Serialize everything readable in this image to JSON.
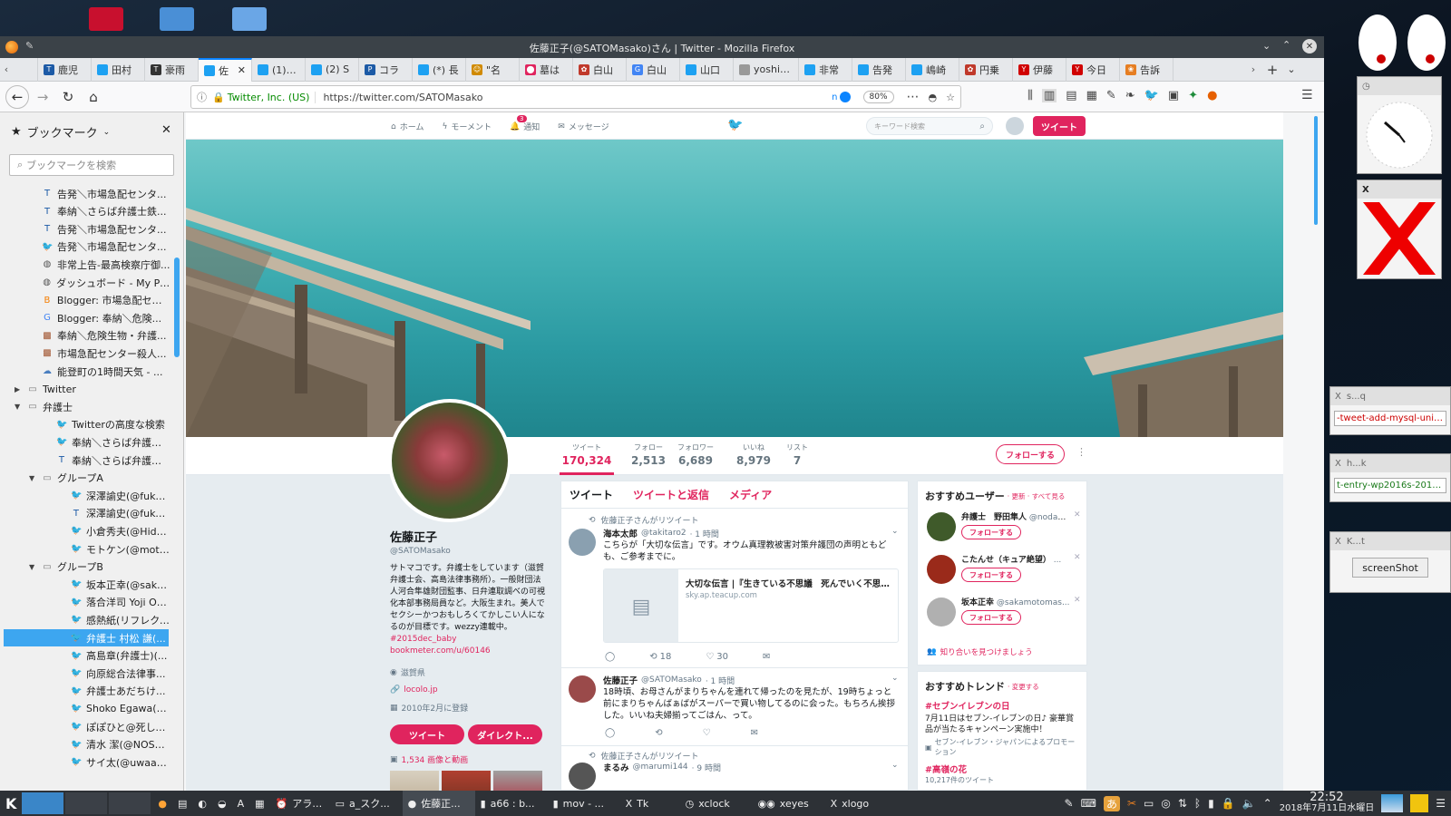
{
  "window": {
    "title": "佐藤正子(@SATOMasako)さん | Twitter - Mozilla Firefox"
  },
  "tabs": [
    {
      "label": "鹿児",
      "color": "#1c5aa6",
      "icon": "tk-icon"
    },
    {
      "label": "田村",
      "color": "#1da1f2",
      "icon": "twitter-icon"
    },
    {
      "label": "豪雨",
      "color": "#333333",
      "icon": "tk-icon"
    },
    {
      "label": "佐",
      "color": "#1da1f2",
      "icon": "twitter-icon",
      "active": true
    },
    {
      "label": "(1) 渡",
      "color": "#1da1f2",
      "icon": "twitter-icon"
    },
    {
      "label": "(2) S",
      "color": "#1da1f2",
      "icon": "twitter-icon"
    },
    {
      "label": "コラ",
      "color": "#1c5aa6",
      "icon": "p-icon"
    },
    {
      "label": "(*) 長",
      "color": "#1da1f2",
      "icon": "twitter-icon"
    },
    {
      "label": "\"名",
      "color": "#d08a00",
      "icon": "emoji-icon"
    },
    {
      "label": "墓は",
      "color": "#e0245e",
      "icon": "pin-icon"
    },
    {
      "label": "白山",
      "color": "#c0392b",
      "icon": "crest-icon"
    },
    {
      "label": "白山",
      "color": "#4285f4",
      "icon": "google-icon"
    },
    {
      "label": "山口",
      "color": "#1da1f2",
      "icon": "twitter-icon"
    },
    {
      "label": "yoshi392",
      "color": "#999999",
      "icon": "blank-icon"
    },
    {
      "label": "非常",
      "color": "#1da1f2",
      "icon": "twitter-icon"
    },
    {
      "label": "告発",
      "color": "#1da1f2",
      "icon": "twitter-icon"
    },
    {
      "label": "嶋崎",
      "color": "#1da1f2",
      "icon": "twitter-icon"
    },
    {
      "label": "円乗",
      "color": "#c0392b",
      "icon": "crest-icon"
    },
    {
      "label": "伊藤",
      "color": "#d00000",
      "icon": "yahoo-icon"
    },
    {
      "label": "今日",
      "color": "#d00000",
      "icon": "yahoo-icon"
    },
    {
      "label": "告訴",
      "color": "#e67e22",
      "icon": "flower-icon"
    }
  ],
  "nav": {
    "site_identity": "Twitter, Inc. (US)",
    "url": "https://twitter.com/SATOMasako",
    "zoom": "80%"
  },
  "sidebar": {
    "title": "ブックマーク",
    "search_placeholder": "ブックマークを検索",
    "items": [
      {
        "label": "告発＼市場急配センタ...",
        "icon": "tk-icon",
        "indent": 3
      },
      {
        "label": "奉納＼さらば弁護士鉄...",
        "icon": "tk-icon",
        "indent": 3
      },
      {
        "label": "告発＼市場急配センタ...",
        "icon": "tk-icon",
        "indent": 3
      },
      {
        "label": "告発＼市場急配センタ...",
        "icon": "twitter-icon",
        "indent": 3
      },
      {
        "label": "非常上告-最高検察庁御...",
        "icon": "globe-icon",
        "indent": 3
      },
      {
        "label": "ダッシュボード - My Pro...",
        "icon": "globe-icon",
        "indent": 3
      },
      {
        "label": "Blogger: 市場急配セン...",
        "icon": "blogger-icon",
        "indent": 3
      },
      {
        "label": "Blogger: 奉納＼危険...",
        "icon": "google-icon",
        "indent": 3
      },
      {
        "label": "奉納＼危険生物・弁護...",
        "icon": "image-icon",
        "indent": 3
      },
      {
        "label": "市場急配センター殺人...",
        "icon": "image-icon",
        "indent": 3
      },
      {
        "label": "能登町の1時間天気 - ...",
        "icon": "weather-icon",
        "indent": 3
      },
      {
        "label": "Twitter",
        "icon": "folder-icon",
        "indent": 2,
        "arrow": "▶"
      },
      {
        "label": "弁護士",
        "icon": "folder-icon",
        "indent": 2,
        "arrow": "▼"
      },
      {
        "label": "Twitterの高度な検索",
        "icon": "twitter-icon",
        "indent": 4
      },
      {
        "label": "奉納＼さらば弁護士...",
        "icon": "twitter-icon",
        "indent": 4
      },
      {
        "label": "奉納＼さらば弁護士...",
        "icon": "tk-icon",
        "indent": 4
      },
      {
        "label": "グループA",
        "icon": "folder-icon",
        "indent": 3,
        "arrow": "▼"
      },
      {
        "label": "深澤諭史(@fuka...",
        "icon": "twitter-icon",
        "indent": 5
      },
      {
        "label": "深澤諭史(@fuka...",
        "icon": "tk-icon",
        "indent": 5
      },
      {
        "label": "小倉秀夫(@Hide...",
        "icon": "twitter-icon",
        "indent": 5
      },
      {
        "label": "モトケン(@moto...",
        "icon": "twitter-icon",
        "indent": 5
      },
      {
        "label": "グループB",
        "icon": "folder-icon",
        "indent": 3,
        "arrow": "▼"
      },
      {
        "label": "坂本正幸(@saka...",
        "icon": "twitter-icon",
        "indent": 5
      },
      {
        "label": "落合洋司 Yoji Oc...",
        "icon": "twitter-icon",
        "indent": 5
      },
      {
        "label": "感熱紙(リフレクタ...",
        "icon": "twitter-icon",
        "indent": 5
      },
      {
        "label": "弁護士 村松 謙(...",
        "icon": "twitter-icon",
        "indent": 5,
        "selected": true
      },
      {
        "label": "高島章(弁護士)(...",
        "icon": "twitter-icon",
        "indent": 5
      },
      {
        "label": "向原総合法律事...",
        "icon": "twitter-icon",
        "indent": 5
      },
      {
        "label": "弁護士あだちけ...",
        "icon": "twitter-icon",
        "indent": 5
      },
      {
        "label": "Shoko Egawa(@...",
        "icon": "twitter-icon",
        "indent": 5
      },
      {
        "label": "ぽぽひと@死して...",
        "icon": "twitter-icon",
        "indent": 5
      },
      {
        "label": "清水 潔(@NOSU...",
        "icon": "twitter-icon",
        "indent": 5
      },
      {
        "label": "サイ太(@uwaaaa...",
        "icon": "twitter-icon",
        "indent": 5
      }
    ]
  },
  "twitter": {
    "topnav": {
      "home": "ホーム",
      "moments": "モーメント",
      "notifications": "通知",
      "notif_badge": "3",
      "messages": "メッセージ",
      "search_placeholder": "キーワード検索",
      "tweet_button": "ツイート"
    },
    "stats": [
      {
        "label": "ツイート",
        "value": "170,324",
        "active": true
      },
      {
        "label": "フォロー",
        "value": "2,513"
      },
      {
        "label": "フォロワー",
        "value": "6,689"
      },
      {
        "label": "いいね",
        "value": "8,979"
      },
      {
        "label": "リスト",
        "value": "7"
      }
    ],
    "follow_button": "フォローする",
    "profile": {
      "name": "佐藤正子",
      "handle": "@SATOMasako",
      "bio": "サトマコです。弁護士をしています（滋賀弁護士会、高島法律事務所）。一般財団法人河合隼雄財団監事、日弁連取調べの可視化本部事務局員など。大阪生まれ。美人でセクシーかつおもしろくてかしこい人になるのが目標です。wezzy連載中。",
      "bio_links": "#2015dec_baby bookmeter.com/u/60146",
      "location": "滋賀県",
      "website": "locolo.jp",
      "joined": "2010年2月に登録",
      "tweet_btn": "ツイート",
      "dm_btn": "ダイレクト...",
      "media": "1,534 画像と動画"
    },
    "timeline_tabs": [
      {
        "label": "ツイート",
        "active": true
      },
      {
        "label": "ツイートと返信"
      },
      {
        "label": "メディア"
      }
    ],
    "tweets": [
      {
        "retweet_context": "佐藤正子さんがリツイート",
        "name": "海本太郎",
        "handle": "@takitaro2",
        "time": "· 1 時間",
        "text": "こちらが「大切な伝言」です。オウム真理教被害対策弁護団の声明ともども、ご参考までに。",
        "card_title": "大切な伝言 |『生きている不思議　死んでいく不思議』...",
        "card_domain": "sky.ap.teacup.com",
        "retweets": "18",
        "likes": "30"
      },
      {
        "name": "佐藤正子",
        "handle": "@SATOMasako",
        "time": "· 1 時間",
        "text": "18時頃、お母さんがまりちゃんを連れて帰ったのを見たが、19時ちょっと前にまりちゃんばぁばがスーパーで買い物してるのに会った。もちろん挨拶した。いいね夫婦揃ってごはん、って。",
        "retweets": "",
        "likes": ""
      },
      {
        "retweet_context": "佐藤正子さんがリツイート",
        "name": "まるみ",
        "handle": "@marumi144",
        "time": "· 9 時間"
      }
    ],
    "who_to_follow": {
      "title": "おすすめユーザー",
      "links": "· 更新 · すべて見る",
      "users": [
        {
          "name": "弁護士　野田隼人",
          "handle": "@nodah...",
          "btn": "フォローする"
        },
        {
          "name": "こたんせ（キュア絶望）",
          "handle": "...",
          "btn": "フォローする"
        },
        {
          "name": "坂本正幸",
          "handle": "@sakamotomas...",
          "btn": "フォローする"
        }
      ],
      "find_friends": "知り合いを見つけましょう"
    },
    "trends": {
      "title": "おすすめトレンド",
      "change": "· 変更する",
      "items": [
        {
          "tag": "#セブンイレブンの日",
          "desc": "7月11日はセブン-イレブンの日♪ 豪華賞品が当たるキャンペーン実施中！",
          "promo": "セブン-イレブン・ジャパンによるプロモーション"
        },
        {
          "tag": "#高嶺の花",
          "desc": "10,217件のツイート"
        }
      ]
    }
  },
  "taskbar": {
    "items": [
      {
        "label": "アラーム",
        "icon": "alarm-icon"
      },
      {
        "label": "a_スク...",
        "icon": "folder-icon"
      },
      {
        "label": "佐藤正...",
        "icon": "firefox-icon",
        "active": true
      },
      {
        "label": "a66 : b...",
        "icon": "terminal-icon"
      },
      {
        "label": "mov - ...",
        "icon": "terminal-icon"
      },
      {
        "label": "Tk",
        "icon": "x-icon"
      },
      {
        "label": "xclock",
        "icon": "clock-icon"
      },
      {
        "label": "xeyes",
        "icon": "eyes-icon"
      },
      {
        "label": "xlogo",
        "icon": "x-icon"
      }
    ],
    "clock_time": "22:52",
    "clock_date": "2018年7月11日水曜日"
  },
  "widgets": {
    "note1": "-tweet-add-mysql-uniq.r",
    "note1_title": "s...q",
    "note2": "t-entry-wp2016s-20161(",
    "note2_title": "h...k",
    "note3_title": "K...t",
    "note3_button": "screenShot"
  }
}
